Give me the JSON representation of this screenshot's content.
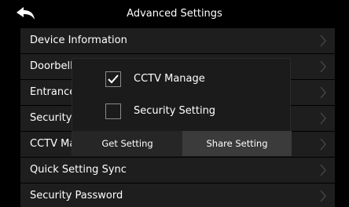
{
  "header": {
    "title": "Advanced Settings",
    "back_icon": "back-arrow-icon"
  },
  "menu": {
    "items": [
      {
        "label": "Device Information"
      },
      {
        "label": "Doorbell"
      },
      {
        "label": "Entrance"
      },
      {
        "label": "Security"
      },
      {
        "label": "CCTV Ma"
      },
      {
        "label": "Quick Setting Sync"
      },
      {
        "label": "Security Password"
      }
    ],
    "chevron_icon": "chevron-right-icon"
  },
  "dialog": {
    "options": [
      {
        "label": "CCTV Manage",
        "checked": true
      },
      {
        "label": "Security Setting",
        "checked": false
      }
    ],
    "get_button": "Get Setting",
    "share_button": "Share Setting"
  },
  "colors": {
    "background": "#000000",
    "row": "#1e1e1e",
    "dialog": "#1b1b1b",
    "button_get": "#262626",
    "button_share": "#3b3b3b"
  }
}
